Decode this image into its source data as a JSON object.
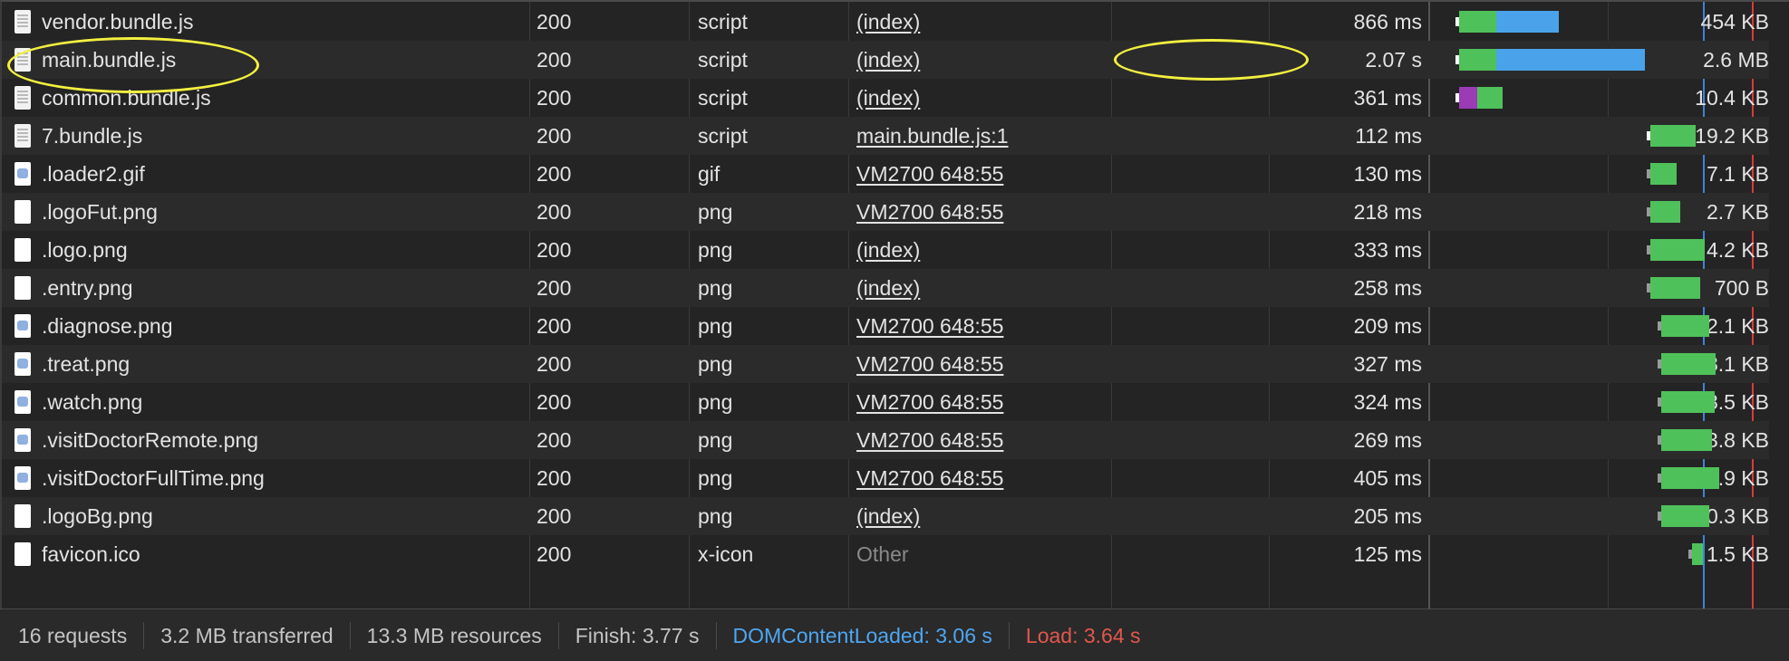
{
  "requests": [
    {
      "name": "vendor.bundle.js",
      "status": "200",
      "type": "script",
      "initiator": "(index)",
      "size": "454 KB",
      "time": "866 ms",
      "icon": "doc-icon",
      "wf": {
        "wait": 0.02,
        "recv": 0.866
      }
    },
    {
      "name": "main.bundle.js",
      "status": "200",
      "type": "script",
      "initiator": "(index)",
      "size": "2.6 MB",
      "time": "2.07 s",
      "icon": "doc-icon",
      "wf": {
        "wait": 0.02,
        "recv": 2.07
      }
    },
    {
      "name": "common.bundle.js",
      "status": "200",
      "type": "script",
      "initiator": "(index)",
      "size": "10.4 KB",
      "time": "361 ms",
      "icon": "doc-icon",
      "wf": {
        "wait": 0.02,
        "recv": 0.361
      }
    },
    {
      "name": "7.bundle.js",
      "status": "200",
      "type": "script",
      "initiator": "main.bundle.js:1",
      "size": "19.2 KB",
      "time": "112 ms",
      "icon": "doc-icon",
      "wf": {
        "wait": 0.02,
        "recv": 0.112
      }
    },
    {
      "name": ".loader2.gif",
      "status": "200",
      "type": "gif",
      "initiator": "VM2700 648:55",
      "size": "7.1 KB",
      "time": "130 ms",
      "icon": "image-icon",
      "wf": {
        "wait": 0.02,
        "recv": 0.13
      }
    },
    {
      "name": ".logoFut.png",
      "status": "200",
      "type": "png",
      "initiator": "VM2700 648:55",
      "size": "2.7 KB",
      "time": "218 ms",
      "icon": "blank-file-icon",
      "wf": {
        "wait": 0.02,
        "recv": 0.218
      }
    },
    {
      "name": ".logo.png",
      "status": "200",
      "type": "png",
      "initiator": "(index)",
      "size": "4.2 KB",
      "time": "333 ms",
      "icon": "blank-file-icon",
      "wf": {
        "wait": 0.04,
        "recv": 0.333
      }
    },
    {
      "name": ".entry.png",
      "status": "200",
      "type": "png",
      "initiator": "(index)",
      "size": "700 B",
      "time": "258 ms",
      "icon": "blank-file-icon",
      "wf": {
        "wait": 0.04,
        "recv": 0.258
      }
    },
    {
      "name": ".diagnose.png",
      "status": "200",
      "type": "png",
      "initiator": "VM2700 648:55",
      "size": "12.1 KB",
      "time": "209 ms",
      "icon": "image-icon",
      "wf": {
        "wait": 0.04,
        "recv": 0.209
      }
    },
    {
      "name": ".treat.png",
      "status": "200",
      "type": "png",
      "initiator": "VM2700 648:55",
      "size": "8.1 KB",
      "time": "327 ms",
      "icon": "image-icon",
      "wf": {
        "wait": 0.04,
        "recv": 0.327
      }
    },
    {
      "name": ".watch.png",
      "status": "200",
      "type": "png",
      "initiator": "VM2700 648:55",
      "size": "8.5 KB",
      "time": "324 ms",
      "icon": "image-icon",
      "wf": {
        "wait": 0.04,
        "recv": 0.324
      }
    },
    {
      "name": ".visitDoctorRemote.png",
      "status": "200",
      "type": "png",
      "initiator": "VM2700 648:55",
      "size": "23.8 KB",
      "time": "269 ms",
      "icon": "image-icon",
      "wf": {
        "wait": 0.04,
        "recv": 0.269
      }
    },
    {
      "name": ".visitDoctorFullTime.png",
      "status": "200",
      "type": "png",
      "initiator": "VM2700 648:55",
      "size": "22.9 KB",
      "time": "405 ms",
      "icon": "image-icon",
      "wf": {
        "wait": 0.04,
        "recv": 0.405
      }
    },
    {
      "name": ".logoBg.png",
      "status": "200",
      "type": "png",
      "initiator": "(index)",
      "size": "10.3 KB",
      "time": "205 ms",
      "icon": "blank-file-icon",
      "wf": {
        "wait": 0.04,
        "recv": 0.205
      }
    },
    {
      "name": "favicon.ico",
      "status": "200",
      "type": "x-icon",
      "initiator": "Other",
      "size": "1.5 KB",
      "time": "125 ms",
      "icon": "blank-file-icon",
      "wf": {
        "wait": 0.0,
        "recv": 0.125
      }
    }
  ],
  "footer": {
    "requests": "16 requests",
    "transferred": "3.2 MB transferred",
    "resources": "13.3 MB resources",
    "finish": "Finish: 3.77 s",
    "dom": "DOMContentLoaded: 3.06 s",
    "load": "Load: 3.64 s"
  },
  "colors": {
    "waiting": "#4fc15a",
    "download": "#4aa3ea",
    "script_wait": "#9b3bb6",
    "dom_line": "#3f83d8",
    "load_line": "#d73b3b",
    "highlight": "#f3f040",
    "dom_text": "#4ea6f2",
    "load_text": "#e2574c"
  }
}
